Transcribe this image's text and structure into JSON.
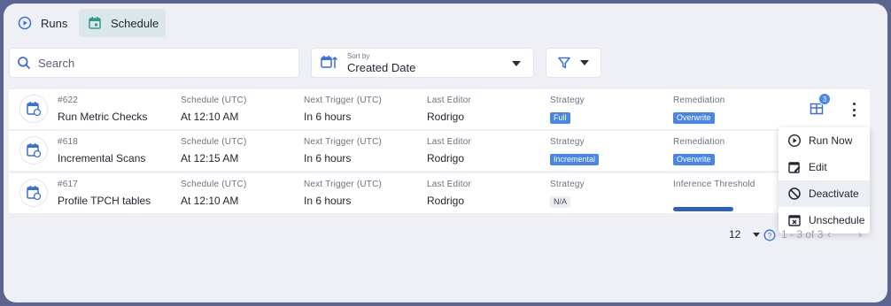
{
  "tabs": [
    {
      "label": "Runs",
      "icon": "play-circle-icon"
    },
    {
      "label": "Schedule",
      "icon": "calendar-icon"
    }
  ],
  "search": {
    "placeholder": "Search"
  },
  "sort": {
    "caption": "Sort by",
    "value": "Created Date"
  },
  "columns": {
    "schedule": "Schedule (UTC)",
    "next_trigger": "Next Trigger (UTC)",
    "last_editor": "Last Editor",
    "strategy": "Strategy",
    "remediation": "Remediation",
    "inference": "Inference Threshold"
  },
  "rows": [
    {
      "id": "#622",
      "name": "Run Metric Checks",
      "schedule": "At 12:10 AM",
      "next": "In 6 hours",
      "editor": "Rodrigo",
      "strategy": "Full",
      "remediation": "Overwrite"
    },
    {
      "id": "#618",
      "name": "Incremental Scans",
      "schedule": "At 12:15 AM",
      "next": "In 6 hours",
      "editor": "Rodrigo",
      "strategy": "Incremental",
      "remediation": "Overwrite"
    },
    {
      "id": "#617",
      "name": "Profile TPCH tables",
      "schedule": "At 12:10 AM",
      "next": "In 6 hours",
      "editor": "Rodrigo",
      "strategy": "N/A"
    }
  ],
  "badge_count": "3",
  "menu": [
    "Run Now",
    "Edit",
    "Deactivate",
    "Unschedule"
  ],
  "pager": {
    "page_size": "12",
    "range": "1 - 3 of 3"
  },
  "colors": {
    "accent": "#4a86e8",
    "frame": "#5b6590",
    "progress": "#2f5ec4"
  }
}
